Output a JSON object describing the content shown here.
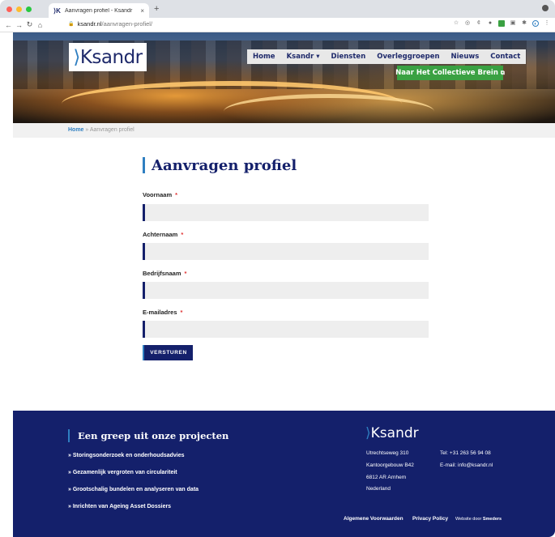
{
  "browser": {
    "tab_title": "Aanvragen profiel - Ksandr",
    "tab_favicon": "ksandr-favicon",
    "new_tab": "+",
    "url_domain": "ksandr.nl",
    "url_path": "/aanvragen-profiel/"
  },
  "site": {
    "logo_prefix": "K",
    "logo_rest": "sandr",
    "nav": [
      "Home",
      "Ksandr ▾",
      "Diensten",
      "Overleggroepen",
      "Nieuws",
      "Contact"
    ],
    "cta": "Naar Het Collectieve Brein"
  },
  "breadcrumb": {
    "home": "Home",
    "separator": " » ",
    "current": "Aanvragen profiel"
  },
  "form": {
    "title": "Aanvragen profiel",
    "fields": [
      {
        "label": "Voornaam",
        "required": "*",
        "value": ""
      },
      {
        "label": "Achternaam",
        "required": "*",
        "value": ""
      },
      {
        "label": "Bedrijfsnaam",
        "required": "*",
        "value": ""
      },
      {
        "label": "E-mailadres",
        "required": "*",
        "value": ""
      }
    ],
    "submit": "VERSTUREN"
  },
  "footer": {
    "title": "Een greep uit onze projecten",
    "links": [
      "» Storingsonderzoek en onderhoudsadvies",
      "» Gezamenlijk vergroten van circulariteit",
      "» Grootschalig bundelen en analyseren van data",
      "» Inrichten van Ageing Asset Dossiers"
    ],
    "logo_prefix": "K",
    "logo_rest": "sandr",
    "address": [
      "Utrechtseweg 310",
      "Kantoorgebouw B42",
      "6812 AR Arnhem",
      "Nederland"
    ],
    "phone": "Tel: +31 263 56 94 08",
    "email": "E-mail: info@ksandr.nl",
    "terms": "Algemene Voorwaarden",
    "privacy": "Privacy Policy",
    "credit_prefix": "Website door",
    "credit_name": "Smeders"
  },
  "colors": {
    "navy": "#14206b",
    "accent_blue": "#2f7fc1",
    "green": "#3aa142",
    "required": "#e03131"
  }
}
